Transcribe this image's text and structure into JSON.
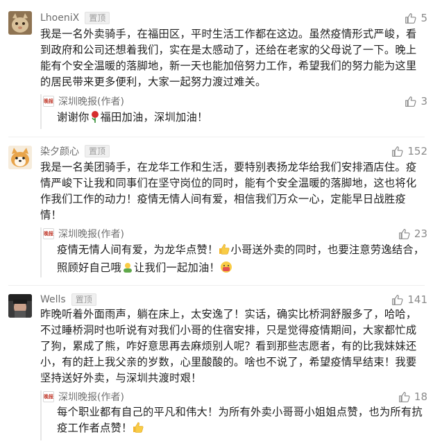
{
  "comments": [
    {
      "user": "LhoeniX",
      "badge": "置顶",
      "likes": "5",
      "text": "我是一名外卖骑手，在福田区，平时生活工作都在这边。虽然疫情形式严峻，看到政府和公司还想着我们，实在是太感动了，还给在老家的父母说了一下。晚上能有个安全温暖的落脚地，新一天也能加倍努力工作，希望我们的努力能为这里的居民带来更多便利，大家一起努力渡过难关。",
      "reply": {
        "author": "深圳晚报(作者)",
        "likes": "3",
        "text_before": "谢谢你",
        "emoji": "rose",
        "text_after": "福田加油，深圳加油！"
      }
    },
    {
      "user": "染夕颜心",
      "badge": "置顶",
      "likes": "152",
      "text": "我是一名美团骑手，在龙华工作和生活，要特别表扬龙华给我们安排酒店住。疫情严峻下让我和同事们在坚守岗位的同时，能有个安全温暖的落脚地，这也将化作我们工作的动力！疫情无情人间有爱，相信我们万众一心，定能早日战胜疫情！",
      "reply": {
        "author": "深圳晚报(作者)",
        "likes": "23",
        "text_a": "疫情无情人间有爱，为龙华点赞！",
        "text_b": "小哥送外卖的同时，也要注意劳逸结合，照顾好自己哦",
        "text_c": "让我们一起加油！"
      }
    },
    {
      "user": "Wells",
      "badge": "置顶",
      "likes": "141",
      "text": "昨晚听着外面雨声，躺在床上，太安逸了！实话，确实比桥洞舒服多了，哈哈，不过睡桥洞时也听说有对我们小哥的住宿安排，只是觉得疫情期间，大家都忙成了狗，累成了熊，咋好意思再去麻烦别人呢？看到那些志愿者，有的比我妹妹还小，有的赶上我父亲的岁数，心里酸酸的。啥也不说了，希望疫情早结束！我要坚持送好外卖，与深圳共渡时艰！",
      "reply": {
        "author": "深圳晚报(作者)",
        "likes": "18",
        "text": "每个职业都有自己的平凡和伟大！为所有外卖小哥哥小姐姐点赞，也为所有抗疫工作者点赞！"
      }
    }
  ]
}
